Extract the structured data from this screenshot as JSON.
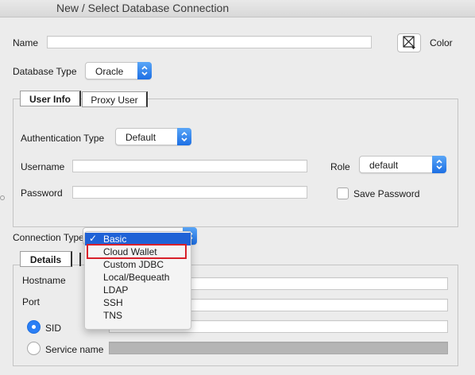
{
  "window": {
    "title": "New / Select Database Connection"
  },
  "name": {
    "label": "Name",
    "value": ""
  },
  "color": {
    "label": "Color",
    "icon": "color-picker-icon"
  },
  "database_type": {
    "label": "Database Type",
    "value": "Oracle"
  },
  "user_tabs": {
    "items": [
      "User Info",
      "Proxy User"
    ],
    "active": "User Info"
  },
  "auth": {
    "label": "Authentication Type",
    "value": "Default"
  },
  "username": {
    "label": "Username",
    "value": ""
  },
  "password": {
    "label": "Password",
    "value": ""
  },
  "role": {
    "label": "Role",
    "value": "default"
  },
  "save_password": {
    "label": "Save Password",
    "checked": false
  },
  "connection_type": {
    "label": "Connection Type",
    "value": "Basic",
    "options": [
      "Basic",
      "Cloud Wallet",
      "Custom JDBC",
      "Local/Bequeath",
      "LDAP",
      "SSH",
      "TNS"
    ],
    "highlighted": "Cloud Wallet"
  },
  "details_tabs": {
    "items": [
      "Details"
    ],
    "active": "Details"
  },
  "hostname": {
    "label": "Hostname",
    "value": ""
  },
  "port": {
    "label": "Port",
    "value": ""
  },
  "sid": {
    "label": "SID",
    "selected": true,
    "value": ""
  },
  "service_name": {
    "label": "Service name",
    "selected": false,
    "value": ""
  },
  "colors": {
    "accent": "#1f62d6",
    "highlight_border": "#d8202a"
  }
}
